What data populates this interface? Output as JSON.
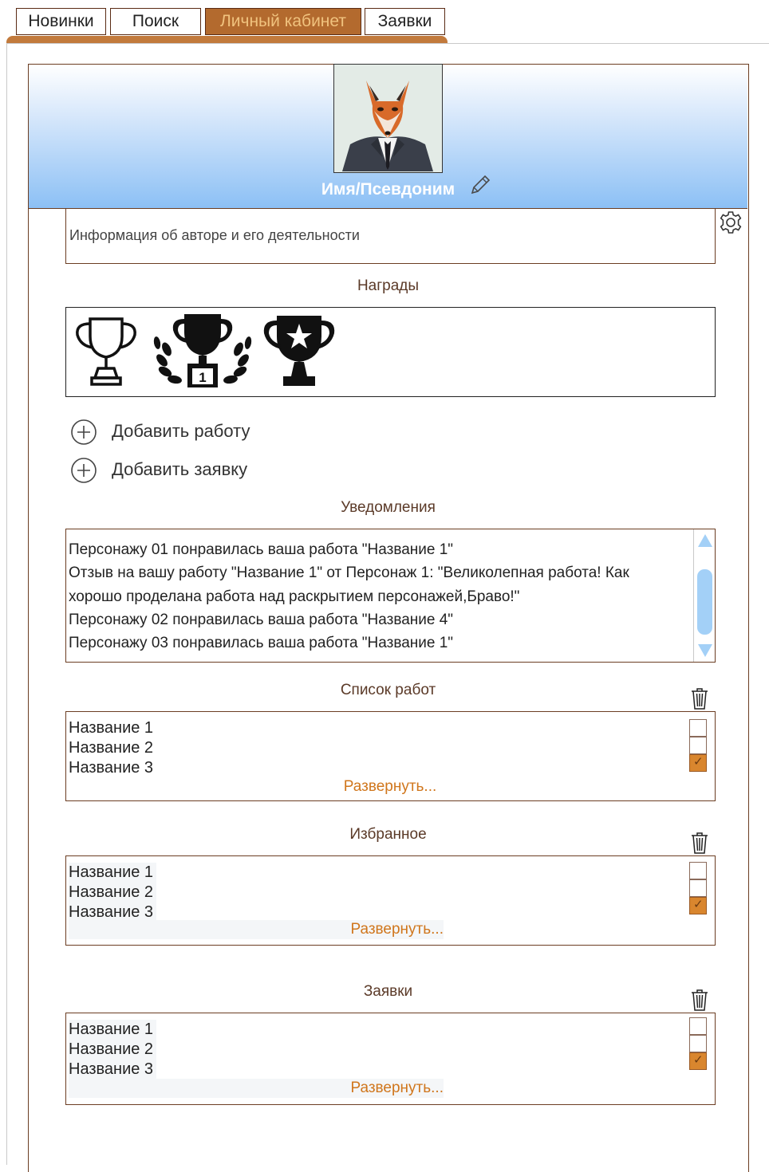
{
  "tabs": [
    {
      "label": "Новинки",
      "active": false
    },
    {
      "label": "Поиск",
      "active": false
    },
    {
      "label": "Личный кабинет",
      "active": true
    },
    {
      "label": "Заявки",
      "active": false
    }
  ],
  "profile": {
    "username": "Имя/Псевдоним",
    "about": "Информация об авторе и его деятельности"
  },
  "awards": {
    "title": "Награды",
    "items": [
      "trophy-outline-icon",
      "trophy-laurel-first-place-icon",
      "trophy-star-icon"
    ]
  },
  "actions": {
    "add_work": "Добавить работу",
    "add_request": "Добавить заявку"
  },
  "notifications": {
    "title": "Уведомления",
    "items": [
      "Персонажу 01 понравилась ваша работа \"Название 1\"",
      "Отзыв на вашу работу \"Название 1\" от Персонаж 1: \"Великолепная работа! Как",
      "хорошо проделана работа над раскрытием персонажей,Браво!\"",
      "Персонажу 02 понравилась ваша работа \"Название 4\"",
      "Персонажу 03 понравилась ваша работа \"Название 1\""
    ]
  },
  "works": {
    "title": "Список работ",
    "items": [
      "Название 1",
      "Название 2",
      "Название 3"
    ],
    "checked": [
      false,
      false,
      true
    ],
    "expand": "Развернуть..."
  },
  "favorites": {
    "title": "Избранное",
    "items": [
      "Название 1",
      "Название 2",
      "Название 3"
    ],
    "checked": [
      false,
      false,
      true
    ],
    "expand": "Развернуть..."
  },
  "requests": {
    "title": "Заявки",
    "items": [
      "Название 1",
      "Название 2",
      "Название 3"
    ],
    "checked": [
      false,
      false,
      true
    ],
    "expand": "Развернуть..."
  },
  "colors": {
    "accent": "#c27a3c",
    "active_tab_bg": "#b36a2e",
    "link": "#d0761c",
    "border": "#6b3d22",
    "header_gradient_end": "#8cc0f5"
  }
}
